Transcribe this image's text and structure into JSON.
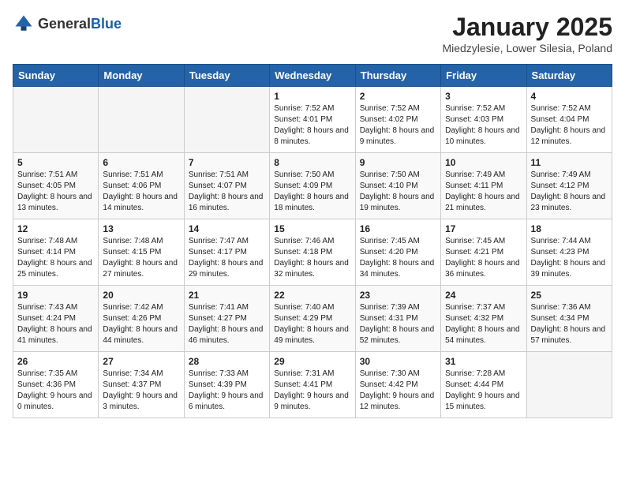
{
  "header": {
    "logo_general": "General",
    "logo_blue": "Blue",
    "title": "January 2025",
    "subtitle": "Miedzylesie, Lower Silesia, Poland"
  },
  "weekdays": [
    "Sunday",
    "Monday",
    "Tuesday",
    "Wednesday",
    "Thursday",
    "Friday",
    "Saturday"
  ],
  "weeks": [
    [
      {
        "num": "",
        "info": ""
      },
      {
        "num": "",
        "info": ""
      },
      {
        "num": "",
        "info": ""
      },
      {
        "num": "1",
        "info": "Sunrise: 7:52 AM\nSunset: 4:01 PM\nDaylight: 8 hours\nand 8 minutes."
      },
      {
        "num": "2",
        "info": "Sunrise: 7:52 AM\nSunset: 4:02 PM\nDaylight: 8 hours\nand 9 minutes."
      },
      {
        "num": "3",
        "info": "Sunrise: 7:52 AM\nSunset: 4:03 PM\nDaylight: 8 hours\nand 10 minutes."
      },
      {
        "num": "4",
        "info": "Sunrise: 7:52 AM\nSunset: 4:04 PM\nDaylight: 8 hours\nand 12 minutes."
      }
    ],
    [
      {
        "num": "5",
        "info": "Sunrise: 7:51 AM\nSunset: 4:05 PM\nDaylight: 8 hours\nand 13 minutes."
      },
      {
        "num": "6",
        "info": "Sunrise: 7:51 AM\nSunset: 4:06 PM\nDaylight: 8 hours\nand 14 minutes."
      },
      {
        "num": "7",
        "info": "Sunrise: 7:51 AM\nSunset: 4:07 PM\nDaylight: 8 hours\nand 16 minutes."
      },
      {
        "num": "8",
        "info": "Sunrise: 7:50 AM\nSunset: 4:09 PM\nDaylight: 8 hours\nand 18 minutes."
      },
      {
        "num": "9",
        "info": "Sunrise: 7:50 AM\nSunset: 4:10 PM\nDaylight: 8 hours\nand 19 minutes."
      },
      {
        "num": "10",
        "info": "Sunrise: 7:49 AM\nSunset: 4:11 PM\nDaylight: 8 hours\nand 21 minutes."
      },
      {
        "num": "11",
        "info": "Sunrise: 7:49 AM\nSunset: 4:12 PM\nDaylight: 8 hours\nand 23 minutes."
      }
    ],
    [
      {
        "num": "12",
        "info": "Sunrise: 7:48 AM\nSunset: 4:14 PM\nDaylight: 8 hours\nand 25 minutes."
      },
      {
        "num": "13",
        "info": "Sunrise: 7:48 AM\nSunset: 4:15 PM\nDaylight: 8 hours\nand 27 minutes."
      },
      {
        "num": "14",
        "info": "Sunrise: 7:47 AM\nSunset: 4:17 PM\nDaylight: 8 hours\nand 29 minutes."
      },
      {
        "num": "15",
        "info": "Sunrise: 7:46 AM\nSunset: 4:18 PM\nDaylight: 8 hours\nand 32 minutes."
      },
      {
        "num": "16",
        "info": "Sunrise: 7:45 AM\nSunset: 4:20 PM\nDaylight: 8 hours\nand 34 minutes."
      },
      {
        "num": "17",
        "info": "Sunrise: 7:45 AM\nSunset: 4:21 PM\nDaylight: 8 hours\nand 36 minutes."
      },
      {
        "num": "18",
        "info": "Sunrise: 7:44 AM\nSunset: 4:23 PM\nDaylight: 8 hours\nand 39 minutes."
      }
    ],
    [
      {
        "num": "19",
        "info": "Sunrise: 7:43 AM\nSunset: 4:24 PM\nDaylight: 8 hours\nand 41 minutes."
      },
      {
        "num": "20",
        "info": "Sunrise: 7:42 AM\nSunset: 4:26 PM\nDaylight: 8 hours\nand 44 minutes."
      },
      {
        "num": "21",
        "info": "Sunrise: 7:41 AM\nSunset: 4:27 PM\nDaylight: 8 hours\nand 46 minutes."
      },
      {
        "num": "22",
        "info": "Sunrise: 7:40 AM\nSunset: 4:29 PM\nDaylight: 8 hours\nand 49 minutes."
      },
      {
        "num": "23",
        "info": "Sunrise: 7:39 AM\nSunset: 4:31 PM\nDaylight: 8 hours\nand 52 minutes."
      },
      {
        "num": "24",
        "info": "Sunrise: 7:37 AM\nSunset: 4:32 PM\nDaylight: 8 hours\nand 54 minutes."
      },
      {
        "num": "25",
        "info": "Sunrise: 7:36 AM\nSunset: 4:34 PM\nDaylight: 8 hours\nand 57 minutes."
      }
    ],
    [
      {
        "num": "26",
        "info": "Sunrise: 7:35 AM\nSunset: 4:36 PM\nDaylight: 9 hours\nand 0 minutes."
      },
      {
        "num": "27",
        "info": "Sunrise: 7:34 AM\nSunset: 4:37 PM\nDaylight: 9 hours\nand 3 minutes."
      },
      {
        "num": "28",
        "info": "Sunrise: 7:33 AM\nSunset: 4:39 PM\nDaylight: 9 hours\nand 6 minutes."
      },
      {
        "num": "29",
        "info": "Sunrise: 7:31 AM\nSunset: 4:41 PM\nDaylight: 9 hours\nand 9 minutes."
      },
      {
        "num": "30",
        "info": "Sunrise: 7:30 AM\nSunset: 4:42 PM\nDaylight: 9 hours\nand 12 minutes."
      },
      {
        "num": "31",
        "info": "Sunrise: 7:28 AM\nSunset: 4:44 PM\nDaylight: 9 hours\nand 15 minutes."
      },
      {
        "num": "",
        "info": ""
      }
    ]
  ]
}
